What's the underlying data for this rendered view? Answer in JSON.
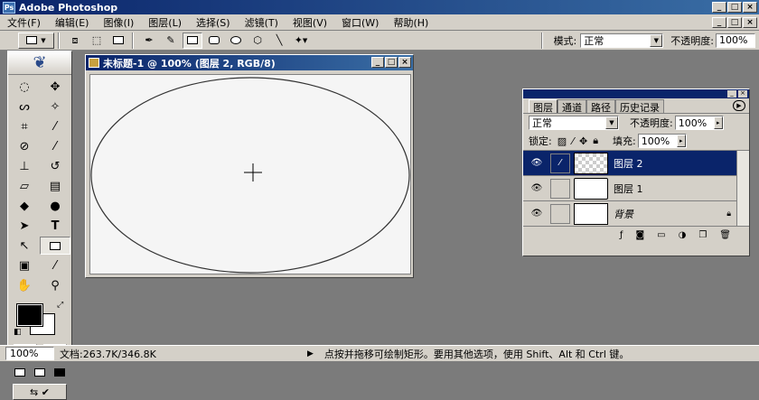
{
  "app": {
    "title": "Adobe Photoshop"
  },
  "menu": [
    "文件(F)",
    "编辑(E)",
    "图像(I)",
    "图层(L)",
    "选择(S)",
    "滤镜(T)",
    "视图(V)",
    "窗口(W)",
    "帮助(H)"
  ],
  "options": {
    "mode_label": "模式:",
    "mode_value": "正常",
    "opacity_label": "不透明度:",
    "opacity_value": "100%"
  },
  "document": {
    "title": "未标题-1 @ 100% (图层 2, RGB/8)"
  },
  "layers_panel": {
    "tabs": [
      "图层",
      "通道",
      "路径",
      "历史记录"
    ],
    "blend_mode": "正常",
    "opacity_label": "不透明度:",
    "opacity_value": "100%",
    "lock_label": "锁定:",
    "fill_label": "填充:",
    "fill_value": "100%",
    "layers": [
      {
        "name": "图层 2",
        "active": true
      },
      {
        "name": "图层 1",
        "active": false
      },
      {
        "name": "背景",
        "active": false
      }
    ]
  },
  "status": {
    "zoom": "100%",
    "doc_size": "文档:263.7K/346.8K",
    "hint": "点按并拖移可绘制矩形。要用其他选项，使用 Shift、Alt 和 Ctrl 键。"
  },
  "colors": {
    "titlebar": "#0a246a",
    "chrome": "#d4d0c8",
    "workspace": "#7b7b7b"
  }
}
